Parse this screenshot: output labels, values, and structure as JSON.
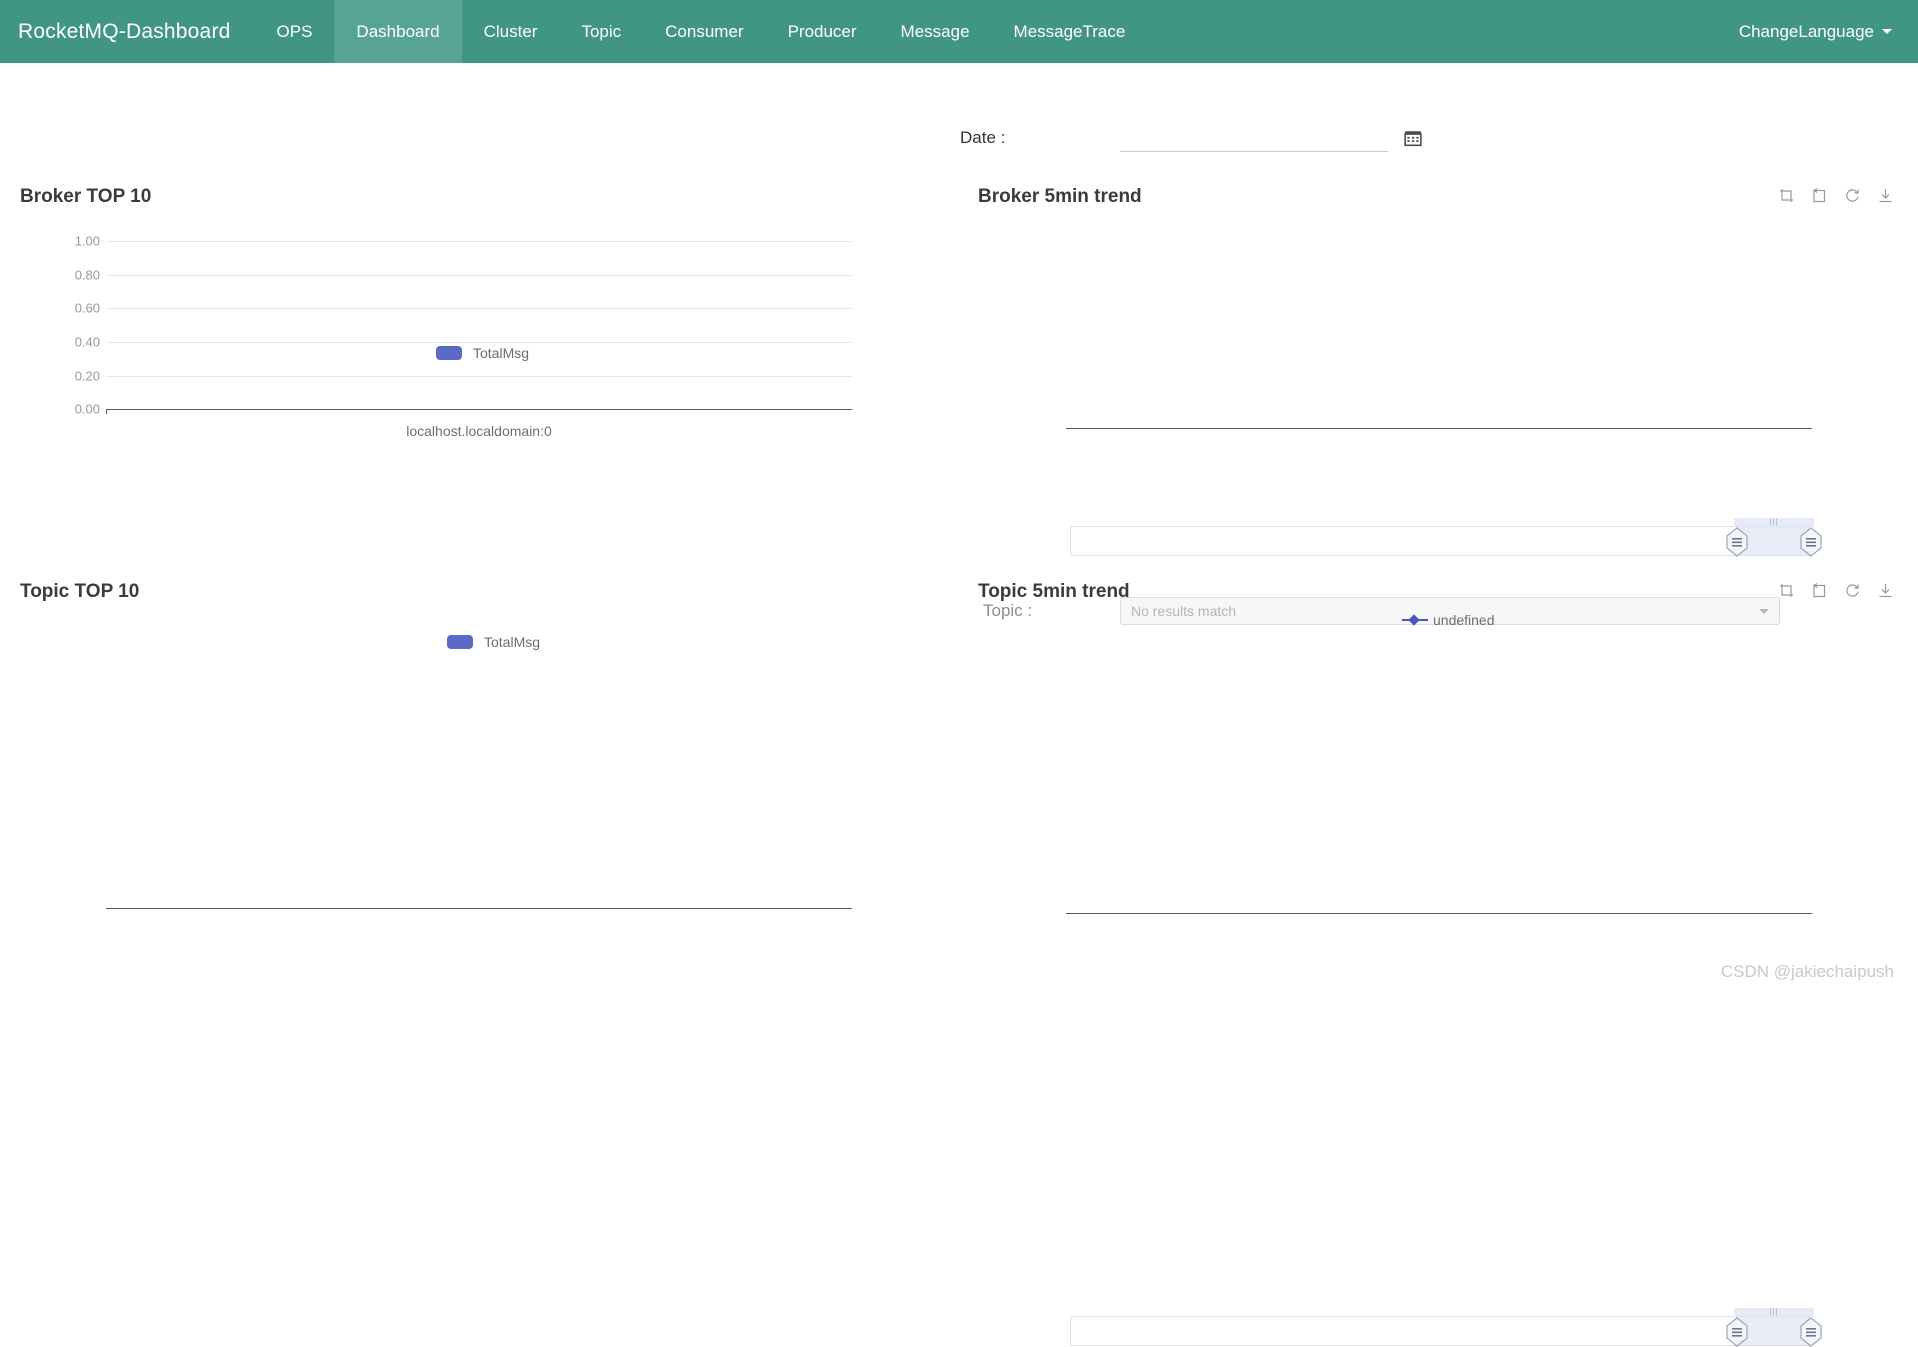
{
  "navbar": {
    "brand": "RocketMQ-Dashboard",
    "items": [
      {
        "label": "OPS",
        "active": false
      },
      {
        "label": "Dashboard",
        "active": true
      },
      {
        "label": "Cluster",
        "active": false
      },
      {
        "label": "Topic",
        "active": false
      },
      {
        "label": "Consumer",
        "active": false
      },
      {
        "label": "Producer",
        "active": false
      },
      {
        "label": "Message",
        "active": false
      },
      {
        "label": "MessageTrace",
        "active": false
      }
    ],
    "change_language": "ChangeLanguage",
    "bg_color": "#409585",
    "active_bg_color": "#57a395"
  },
  "filters": {
    "date_label": "Date :",
    "date_value": "",
    "date_placeholder": "",
    "calendar_icon": "calendar-icon",
    "topic_label": "Topic :",
    "topic_selected": "No results match"
  },
  "panels": {
    "broker_top": {
      "title": "Broker TOP 10",
      "legend": "TotalMsg",
      "legend_color": "#5b6ac7"
    },
    "broker_trend": {
      "title": "Broker 5min trend"
    },
    "topic_top": {
      "title": "Topic TOP 10",
      "legend": "TotalMsg",
      "legend_color": "#5b6ac7"
    },
    "topic_trend": {
      "title": "Topic 5min trend",
      "legend": "undefined",
      "legend_color": "#4b56c4"
    }
  },
  "toolbox": {
    "icons": [
      {
        "name": "data-zoom-icon",
        "title": "Data Zoom"
      },
      {
        "name": "restore-icon",
        "title": "Restore"
      },
      {
        "name": "refresh-icon",
        "title": "Refresh"
      },
      {
        "name": "download-icon",
        "title": "Save as Image"
      }
    ]
  },
  "watermark": "CSDN @jakiechaipush",
  "chart_data": [
    {
      "id": "broker-top-10",
      "type": "bar",
      "title": "Broker TOP 10",
      "categories": [
        "localhost.localdomain:0"
      ],
      "series": [
        {
          "name": "TotalMsg",
          "values": [
            0
          ],
          "color": "#5b6ac7"
        }
      ],
      "xlabel": "",
      "ylabel": "",
      "ylim": [
        0,
        1
      ],
      "yticks": [
        "0.00",
        "0.20",
        "0.40",
        "0.60",
        "0.80",
        "1.00"
      ],
      "grid": true,
      "legend_position": "top-center"
    },
    {
      "id": "broker-5min-trend",
      "type": "line",
      "title": "Broker 5min trend",
      "x": [],
      "series": [],
      "xlabel": "",
      "ylabel": "",
      "grid": false,
      "legend_position": "top-center",
      "datazoom": {
        "start": 92,
        "end": 100
      }
    },
    {
      "id": "topic-top-10",
      "type": "bar",
      "title": "Topic TOP 10",
      "categories": [],
      "series": [
        {
          "name": "TotalMsg",
          "values": [],
          "color": "#5b6ac7"
        }
      ],
      "xlabel": "",
      "ylabel": "",
      "grid": false,
      "legend_position": "top-center"
    },
    {
      "id": "topic-5min-trend",
      "type": "line",
      "title": "Topic 5min trend",
      "x": [],
      "series": [
        {
          "name": "undefined",
          "values": [],
          "color": "#4b56c4"
        }
      ],
      "xlabel": "",
      "ylabel": "",
      "grid": false,
      "legend_position": "top-center",
      "datazoom": {
        "start": 92,
        "end": 100
      }
    }
  ]
}
